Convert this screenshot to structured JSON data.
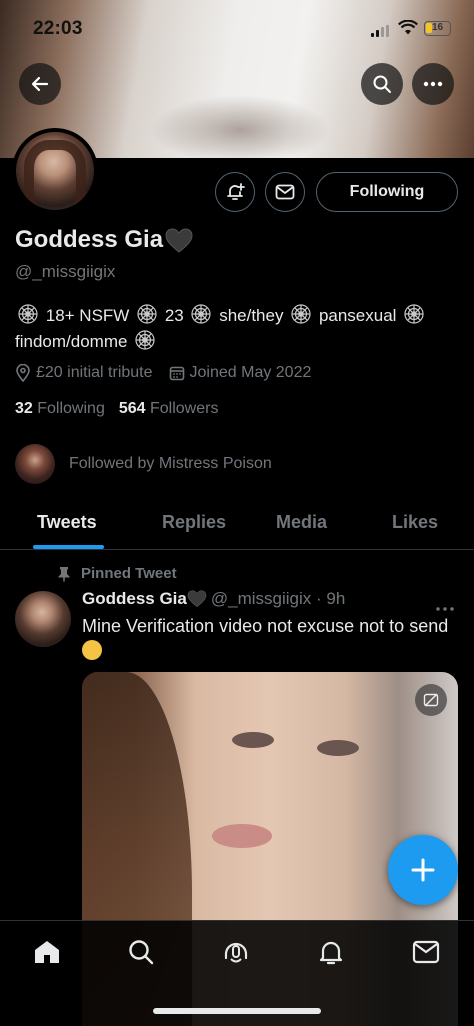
{
  "status_bar": {
    "time": "22:03",
    "battery": "16"
  },
  "profile": {
    "name": "Goddess Gia",
    "handle": "@_missgiigix",
    "bio_parts": [
      "18+ NSFW",
      "23",
      "she/they",
      "pansexual",
      "findom/domme"
    ],
    "location": "£20 initial tribute",
    "joined": "Joined May 2022",
    "following_count": "32",
    "following_label": "Following",
    "followers_count": "564",
    "followers_label": "Followers",
    "followed_by": "Followed by Mistress Poison",
    "follow_button": "Following"
  },
  "tabs": [
    "Tweets",
    "Replies",
    "Media",
    "Likes"
  ],
  "active_tab": "Tweets",
  "pinned_tweet": {
    "pinned_label": "Pinned Tweet",
    "name": "Goddess Gia",
    "handle_time": "@_missgiigix · 9h",
    "text": "Mine Verification video not excuse not to send"
  },
  "colors": {
    "accent": "#1d9bf0",
    "text": "#e7e9ea",
    "muted": "#71767b",
    "background": "#000000"
  },
  "icons": [
    "back-arrow-icon",
    "search-icon",
    "more-icon",
    "bell-plus-icon",
    "envelope-icon",
    "heart-icon",
    "web-icon",
    "location-icon",
    "calendar-icon",
    "pin-icon",
    "plus-icon",
    "home-icon",
    "spaces-icon",
    "bell-icon",
    "mail-icon"
  ]
}
